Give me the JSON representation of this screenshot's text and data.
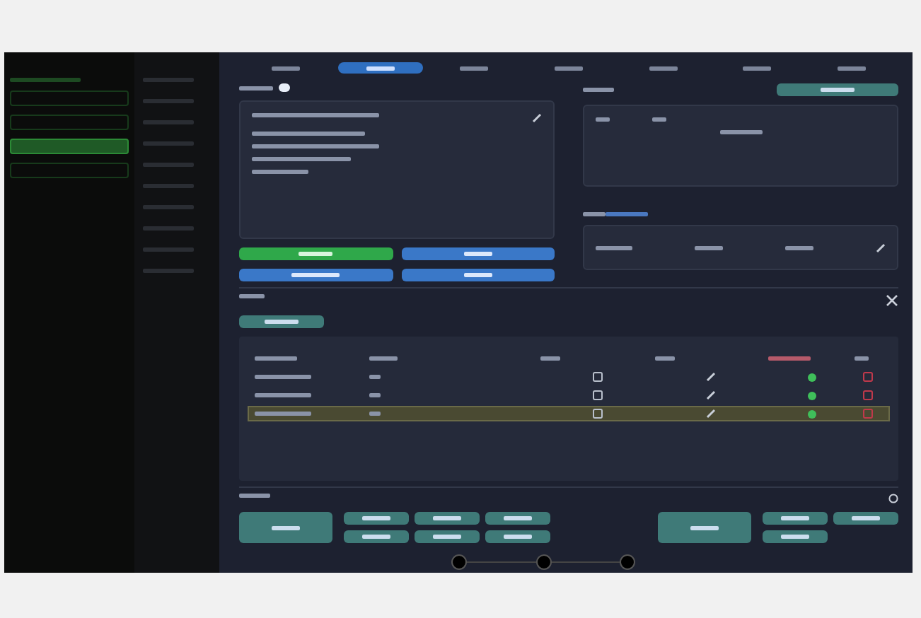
{
  "tabs": [
    {
      "selected": false
    },
    {
      "selected": true
    },
    {
      "selected": false
    },
    {
      "selected": false
    },
    {
      "selected": false
    },
    {
      "selected": false
    },
    {
      "selected": false
    }
  ],
  "sidebar": {
    "items": [
      {
        "selected": false
      },
      {
        "selected": false
      },
      {
        "selected": true
      },
      {
        "selected": false
      }
    ]
  },
  "details": {
    "toggle_on": true
  },
  "devices": {
    "rows": [
      {
        "selected": false,
        "color": "#3fbf5a"
      },
      {
        "selected": false,
        "color": "#3fbf5a"
      },
      {
        "selected": true,
        "color": "#3fbf5a"
      }
    ]
  },
  "stepper": {
    "steps": [
      {
        "kind": "step"
      },
      {
        "kind": "step"
      },
      {
        "kind": "step"
      }
    ]
  }
}
